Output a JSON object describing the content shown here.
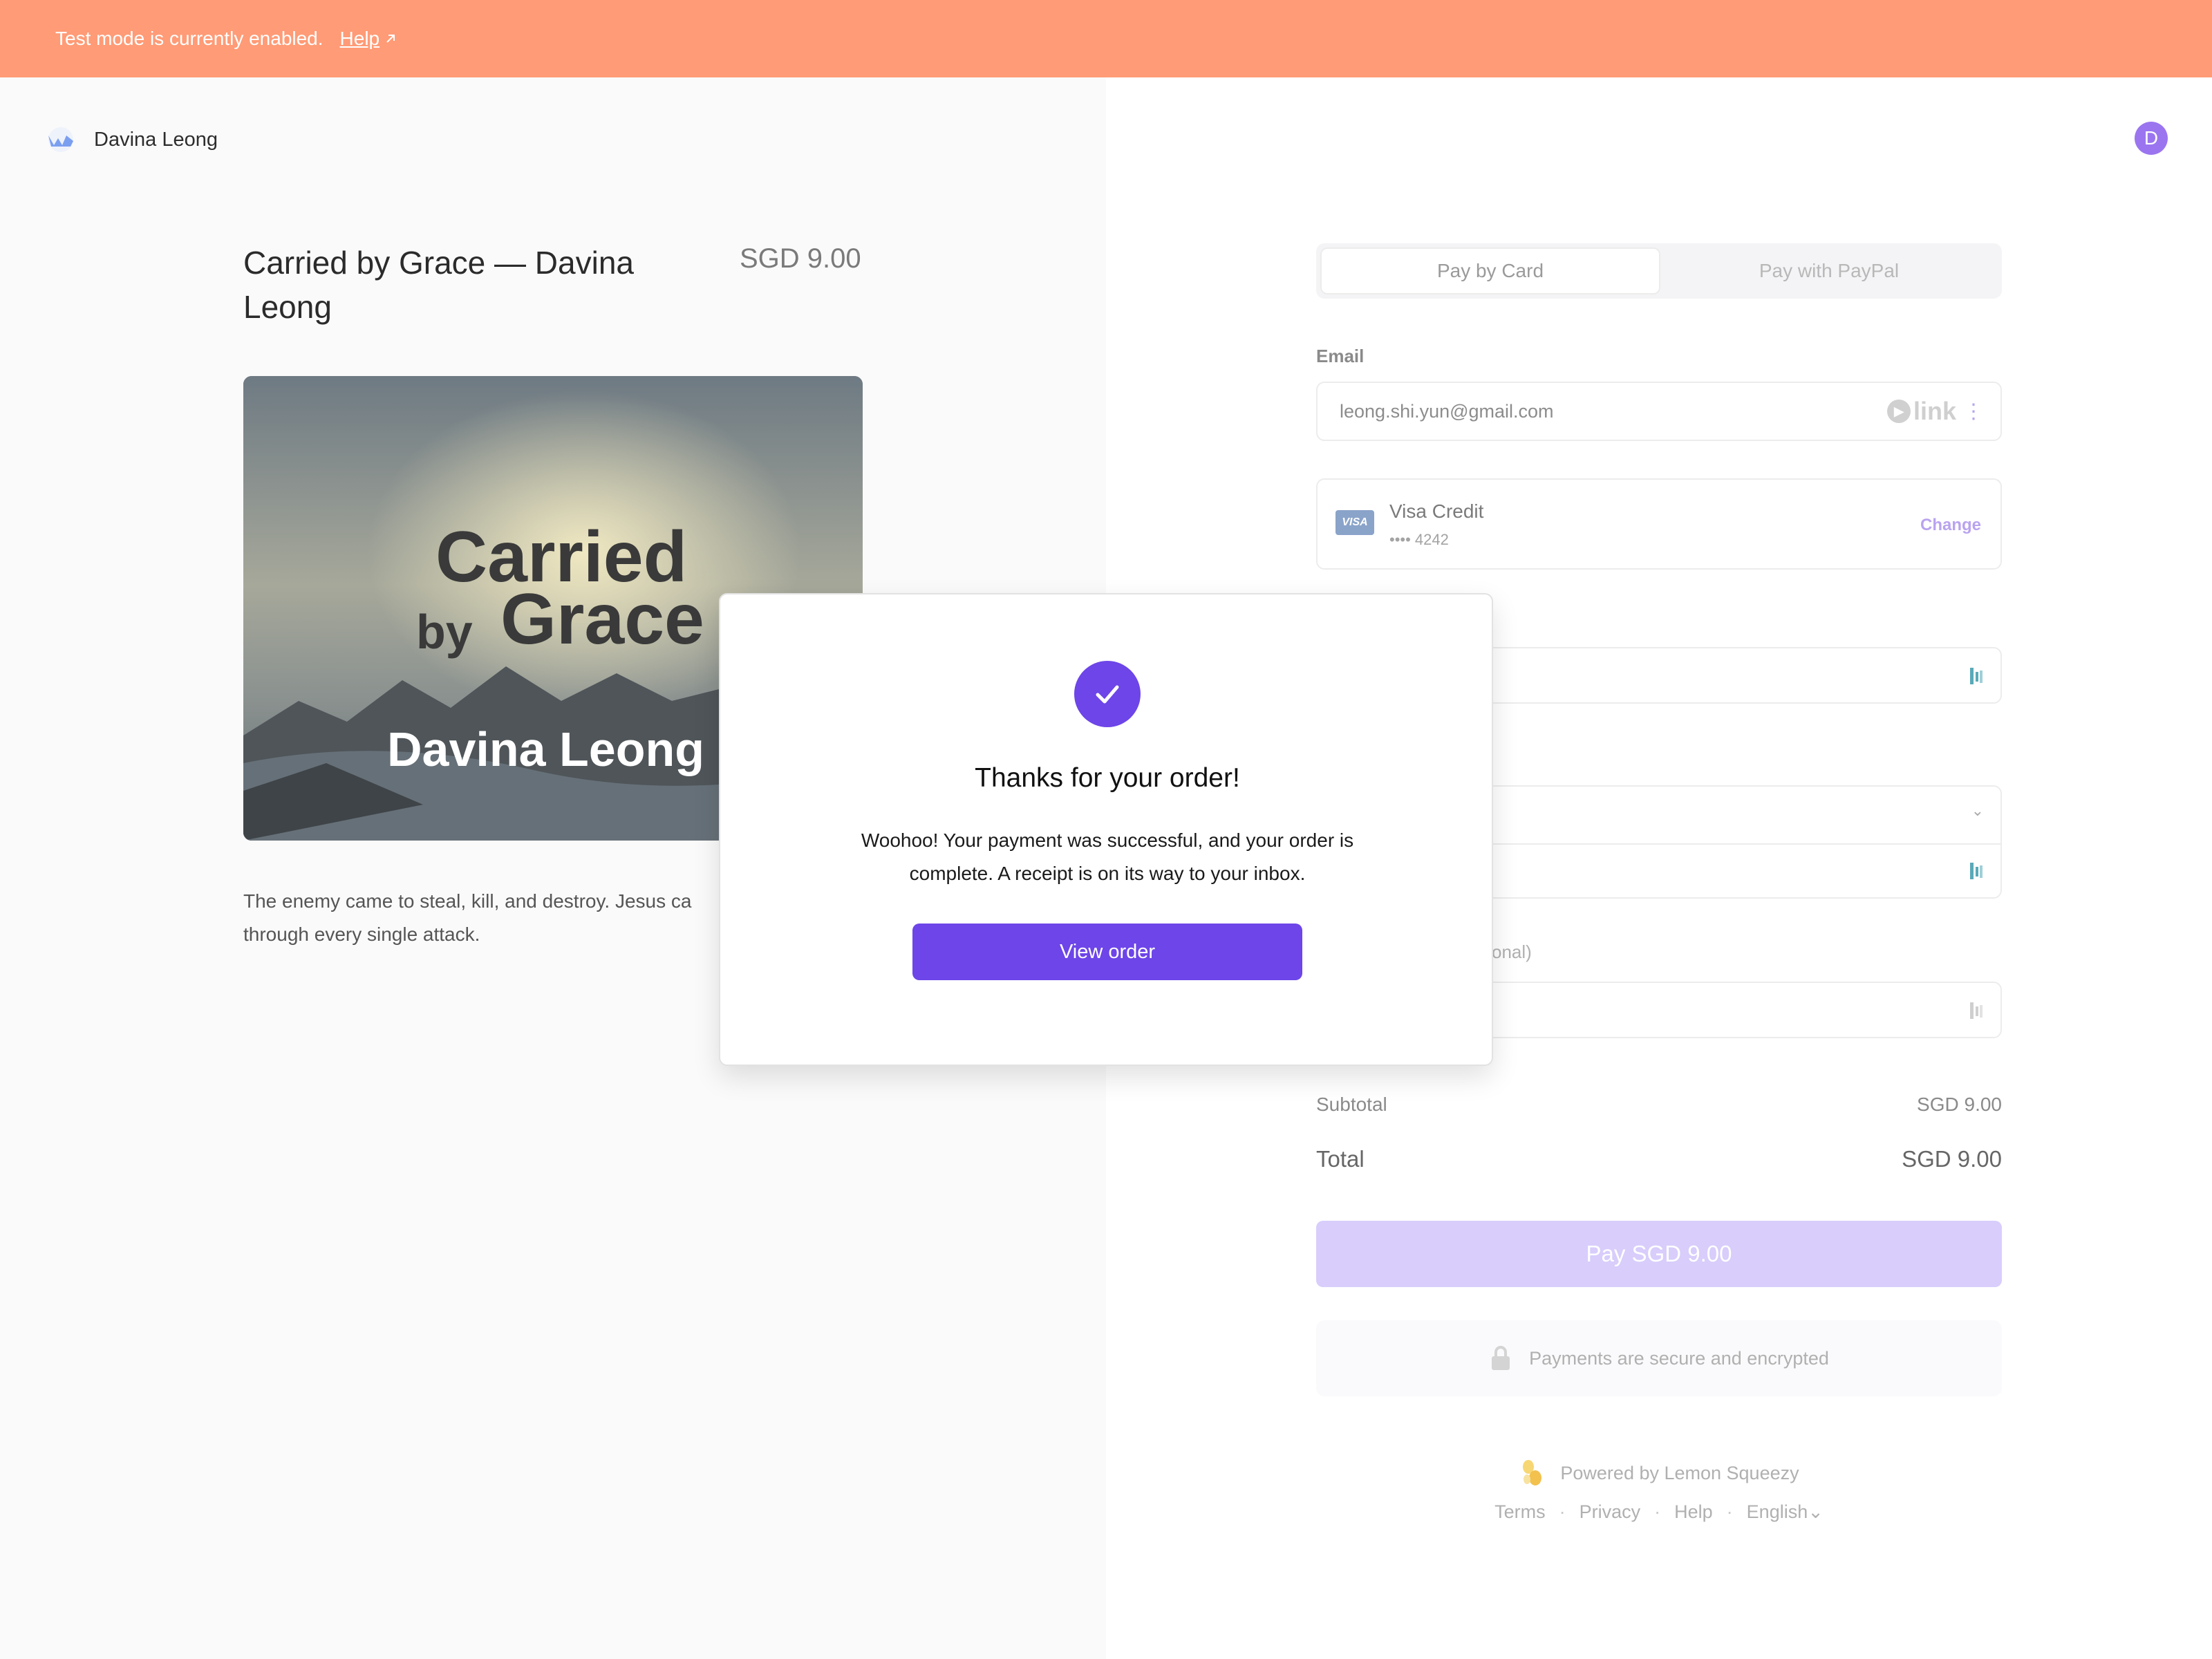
{
  "banner": {
    "text": "Test mode is currently enabled.",
    "help_label": "Help"
  },
  "store": {
    "name": "Davina Leong"
  },
  "product": {
    "title": "Carried by Grace — Davina Leong",
    "price": "SGD 9.00",
    "cover": {
      "line1": "Carried",
      "line2": "by",
      "line3": "Grace",
      "line4": "Davina Leong"
    },
    "description": "The enemy came to steal, kill, and destroy. Jesus ca\nthrough every single attack."
  },
  "user": {
    "avatar_initial": "D"
  },
  "checkout": {
    "tabs": [
      {
        "label": "Pay by Card",
        "active": true
      },
      {
        "label": "Pay with PayPal",
        "active": false
      }
    ],
    "email_label": "Email",
    "email_value": "leong.shi.yun@gmail.com",
    "link_label": "link",
    "card": {
      "brand": "VISA",
      "name": "Visa Credit",
      "number": "•••• 4242",
      "change_label": "Change"
    },
    "optional_label": "onal)",
    "subtotal_label": "Subtotal",
    "subtotal_value": "SGD 9.00",
    "total_label": "Total",
    "total_value": "SGD 9.00",
    "pay_button": "Pay SGD 9.00",
    "secure_text": "Payments are secure and encrypted",
    "powered_by": "Powered by Lemon Squeezy",
    "footer_links": [
      "Terms",
      "Privacy",
      "Help",
      "English"
    ]
  },
  "modal": {
    "title": "Thanks for your order!",
    "body": "Woohoo! Your payment was successful, and your order is complete. A receipt is on its way to your inbox.",
    "button": "View order"
  },
  "colors": {
    "banner": "#ff9b76",
    "accent": "#6d45e8",
    "pay_button_disabled": "#d8cdfb"
  }
}
